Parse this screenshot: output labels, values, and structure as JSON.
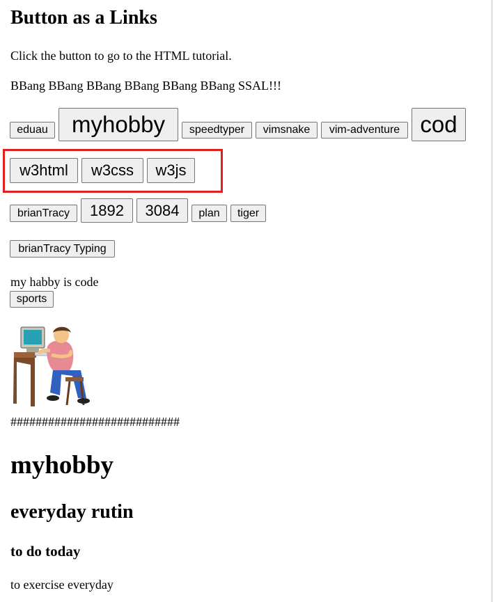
{
  "page": {
    "title": "Button as a Links",
    "intro": "Click the button to go to the HTML tutorial.",
    "chant": "BBang BBang BBang BBang BBang BBang SSAL!!!"
  },
  "row1": [
    "eduau",
    "myhobby",
    "speedtyper",
    "vimsnake",
    "vim-adventure",
    "cod"
  ],
  "row2": [
    "w3html",
    "w3css",
    "w3js"
  ],
  "row3": [
    "brianTracy",
    "1892",
    "3084",
    "plan",
    "tiger"
  ],
  "row4": [
    "brianTracy Typing"
  ],
  "hobby_text": "my habby is code",
  "sports_button": "sports",
  "image": {
    "icon": "person-typing-at-computer-icon"
  },
  "divider": "###########################",
  "headings": {
    "h1": "myhobby",
    "h2": "everyday rutin",
    "h3": "to do today"
  },
  "todo": "to exercise everyday",
  "colors": {
    "highlight": "#e02020",
    "button_bg": "#efefef",
    "button_border": "#767676"
  }
}
